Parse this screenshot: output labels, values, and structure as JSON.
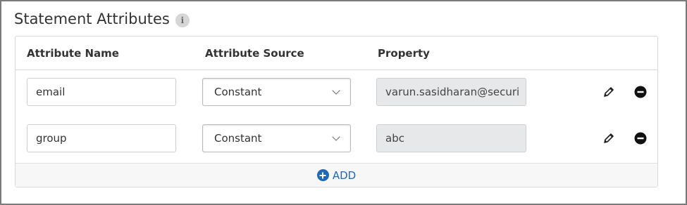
{
  "section": {
    "title": "Statement Attributes",
    "info_glyph": "i"
  },
  "table": {
    "columns": [
      "Attribute Name",
      "Attribute Source",
      "Property"
    ],
    "rows": [
      {
        "name": "email",
        "source": "Constant",
        "property": "varun.sasidharan@securi"
      },
      {
        "name": "group",
        "source": "Constant",
        "property": "abc"
      }
    ],
    "add_label": "ADD"
  },
  "icons": {
    "info": "info-icon",
    "edit": "pencil-icon",
    "remove": "minus-circle-icon",
    "add": "plus-circle-icon",
    "dropdown": "chevron-down-icon"
  },
  "colors": {
    "accent": "#1f69b8",
    "readonly_bg": "#e6e8ea",
    "text": "#333333"
  }
}
